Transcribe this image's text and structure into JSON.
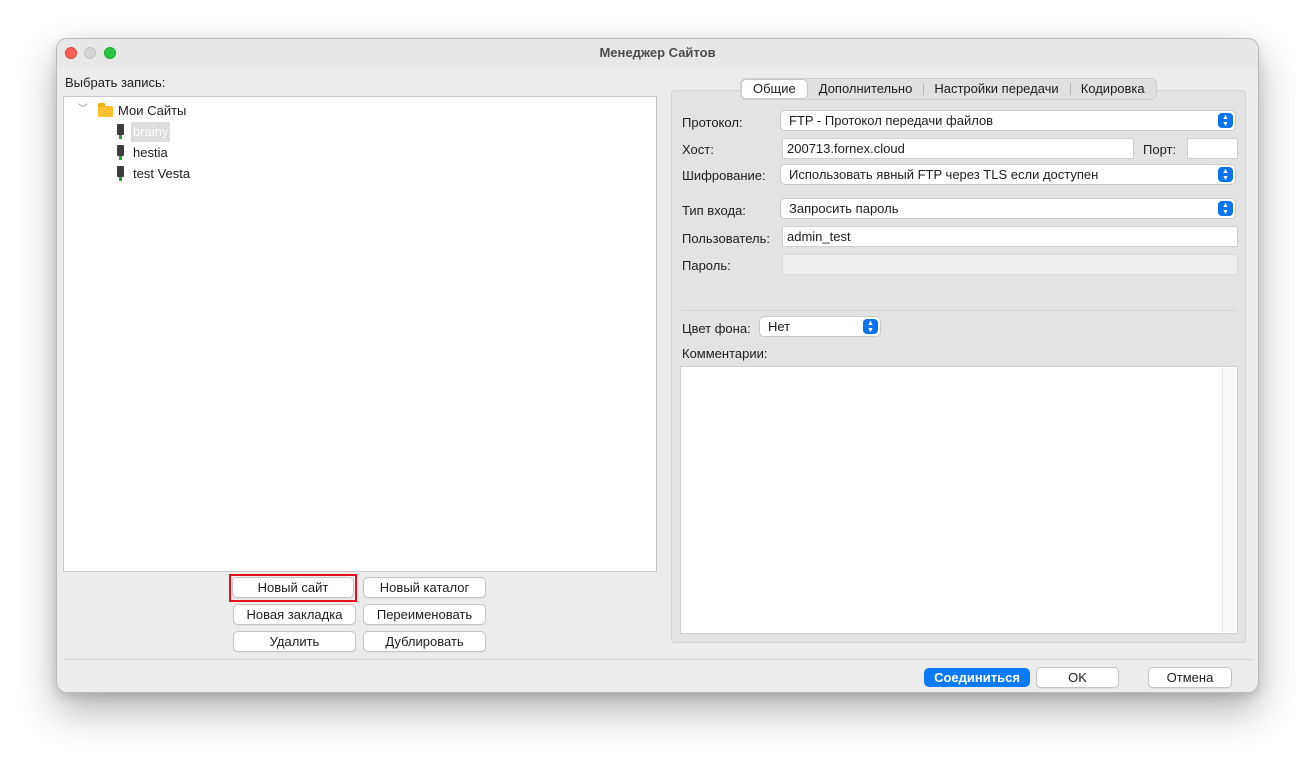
{
  "window": {
    "title": "Менеджер Сайтов"
  },
  "left": {
    "select_label": "Выбрать запись:",
    "tree": {
      "root_label": "Мои Сайты",
      "sites": [
        "brainy",
        "hestia",
        "test Vesta"
      ],
      "selected": "brainy"
    },
    "buttons": {
      "new_site": "Новый сайт",
      "new_folder": "Новый каталог",
      "new_bookmark": "Новая закладка",
      "rename": "Переименовать",
      "delete": "Удалить",
      "duplicate": "Дублировать"
    }
  },
  "tabs": [
    "Общие",
    "Дополнительно",
    "Настройки передачи",
    "Кодировка"
  ],
  "active_tab": "Общие",
  "general": {
    "protocol_label": "Протокол:",
    "protocol_value": "FTP - Протокол передачи файлов",
    "host_label": "Хост:",
    "host_value": "200713.fornex.cloud",
    "port_label": "Порт:",
    "port_value": "",
    "encryption_label": "Шифрование:",
    "encryption_value": "Использовать явный FTP через TLS если доступен",
    "logon_label": "Тип входа:",
    "logon_value": "Запросить пароль",
    "user_label": "Пользователь:",
    "user_value": "admin_test",
    "password_label": "Пароль:",
    "bgcolor_label": "Цвет фона:",
    "bgcolor_value": "Нет",
    "comments_label": "Комментарии:"
  },
  "footer": {
    "connect": "Соединиться",
    "ok": "OK",
    "cancel": "Отмена"
  },
  "colors": {
    "accent": "#0b7af7",
    "highlight": "#e8101b"
  }
}
